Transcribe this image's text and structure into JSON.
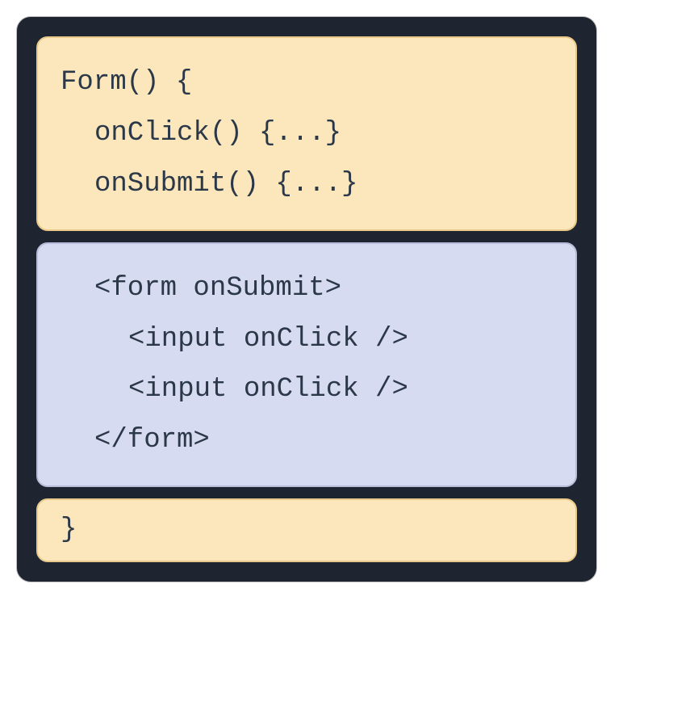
{
  "blocks": {
    "top": {
      "line1": "Form() {",
      "line2": "onClick() {...}",
      "line3": "onSubmit() {...}"
    },
    "middle": {
      "line1": "<form onSubmit>",
      "line2": "<input onClick />",
      "line3": "<input onClick />",
      "line4": "</form>"
    },
    "bottom": {
      "line1": "}"
    }
  }
}
